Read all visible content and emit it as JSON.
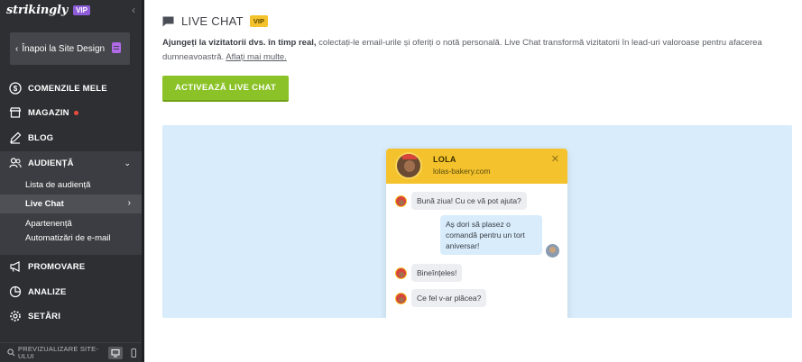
{
  "sidebar": {
    "logo": "strikingly",
    "vip": "VIP",
    "back_label": "Înapoi la Site Design",
    "items": [
      {
        "label": "COMENZILE MELE",
        "icon": "dollar-circle-icon"
      },
      {
        "label": "MAGAZIN",
        "icon": "store-icon",
        "dot": true
      },
      {
        "label": "BLOG",
        "icon": "pen-icon"
      },
      {
        "label": "AUDIENȚĂ",
        "icon": "users-icon"
      },
      {
        "label": "PROMOVARE",
        "icon": "megaphone-icon"
      },
      {
        "label": "ANALIZE",
        "icon": "pie-chart-icon"
      },
      {
        "label": "SETĂRI",
        "icon": "gear-icon"
      }
    ],
    "audience_sub": [
      {
        "label": "Lista de audiență"
      },
      {
        "label": "Live Chat",
        "active": true
      },
      {
        "label": "Apartenență"
      },
      {
        "label": "Automatizări de e-mail"
      }
    ],
    "preview_label": "PREVIZUALIZARE SITE-ULUI"
  },
  "main": {
    "title": "LIVE CHAT",
    "vip": "VIP",
    "desc_bold": "Ajungeți la vizitatorii dvs. în timp real,",
    "desc_text": " colectați-le email-urile și oferiți o notă personală. Live Chat transformă vizitatorii în lead-uri valoroase pentru afacerea dumneavoastră. ",
    "learn_more": "Aflați mai multe.",
    "activate_button": "ACTIVEAZĂ LIVE CHAT"
  },
  "chat_preview": {
    "agent_name": "LOLA",
    "agent_site": "lolas-bakery.com",
    "messages": [
      {
        "from": "agent",
        "text": "Bună ziua! Cu ce vă pot ajuta?"
      },
      {
        "from": "user",
        "text": "Aș dori să plasez o comandă pentru un tort aniversar!"
      },
      {
        "from": "agent",
        "text": "Bineînțeles!"
      },
      {
        "from": "agent",
        "text": "Ce fel v-ar plăcea?"
      }
    ]
  },
  "colors": {
    "sidebar_bg": "#2e2f33",
    "accent_green": "#8ac227",
    "vip_yellow": "#f4c22c",
    "preview_bg": "#d8ecfb"
  }
}
